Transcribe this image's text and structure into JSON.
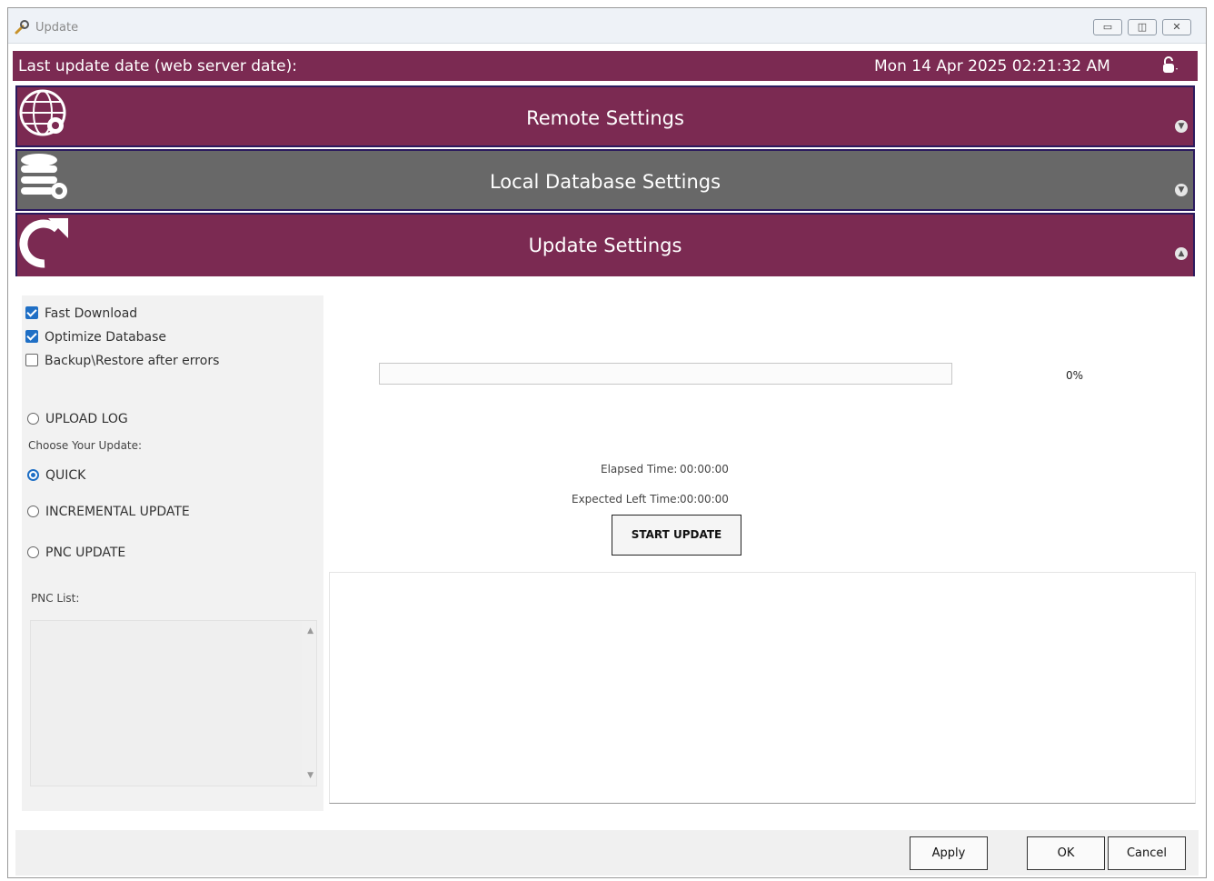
{
  "window": {
    "title": "Update",
    "controls": [
      "minimize",
      "restore",
      "close"
    ]
  },
  "status": {
    "label": "Last update date (web server date):",
    "date": "Mon 14 Apr 2025 02:21:32 AM",
    "lock_icon": "lock-icon"
  },
  "panels": [
    {
      "title": "Remote Settings",
      "icon": "globe-gear-icon",
      "expanded": false,
      "color": "#7b2a52"
    },
    {
      "title": "Local Database Settings",
      "icon": "database-gear-icon",
      "expanded": false,
      "color": "#686868"
    },
    {
      "title": "Update Settings",
      "icon": "refresh-icon",
      "expanded": true,
      "color": "#7b2a52"
    }
  ],
  "options": {
    "fast_download": {
      "label": "Fast Download",
      "checked": true
    },
    "optimize_database": {
      "label": "Optimize Database",
      "checked": true
    },
    "backup_restore": {
      "label": "Backup\\Restore after errors",
      "checked": false
    },
    "upload_log": {
      "label": "UPLOAD LOG",
      "selected": false
    },
    "choose_update_label": "Choose Your Update:",
    "quick": {
      "label": "QUICK",
      "selected": true
    },
    "incremental": {
      "label": "INCREMENTAL UPDATE",
      "selected": false
    },
    "pnc": {
      "label": "PNC UPDATE",
      "selected": false
    },
    "pnc_list_label": "PNC List:"
  },
  "progress": {
    "value": 0,
    "text": "0%",
    "elapsed_label": "Elapsed Time:",
    "elapsed_value": "00:00:00",
    "expected_label": "Expected Left Time:",
    "expected_value": "00:00:00",
    "start_label": "START UPDATE"
  },
  "buttons": {
    "apply": "Apply",
    "ok": "OK",
    "cancel": "Cancel"
  },
  "colors": {
    "accent": "#7b2a52",
    "local_panel": "#686868",
    "checkbox": "#1f6fc5"
  }
}
